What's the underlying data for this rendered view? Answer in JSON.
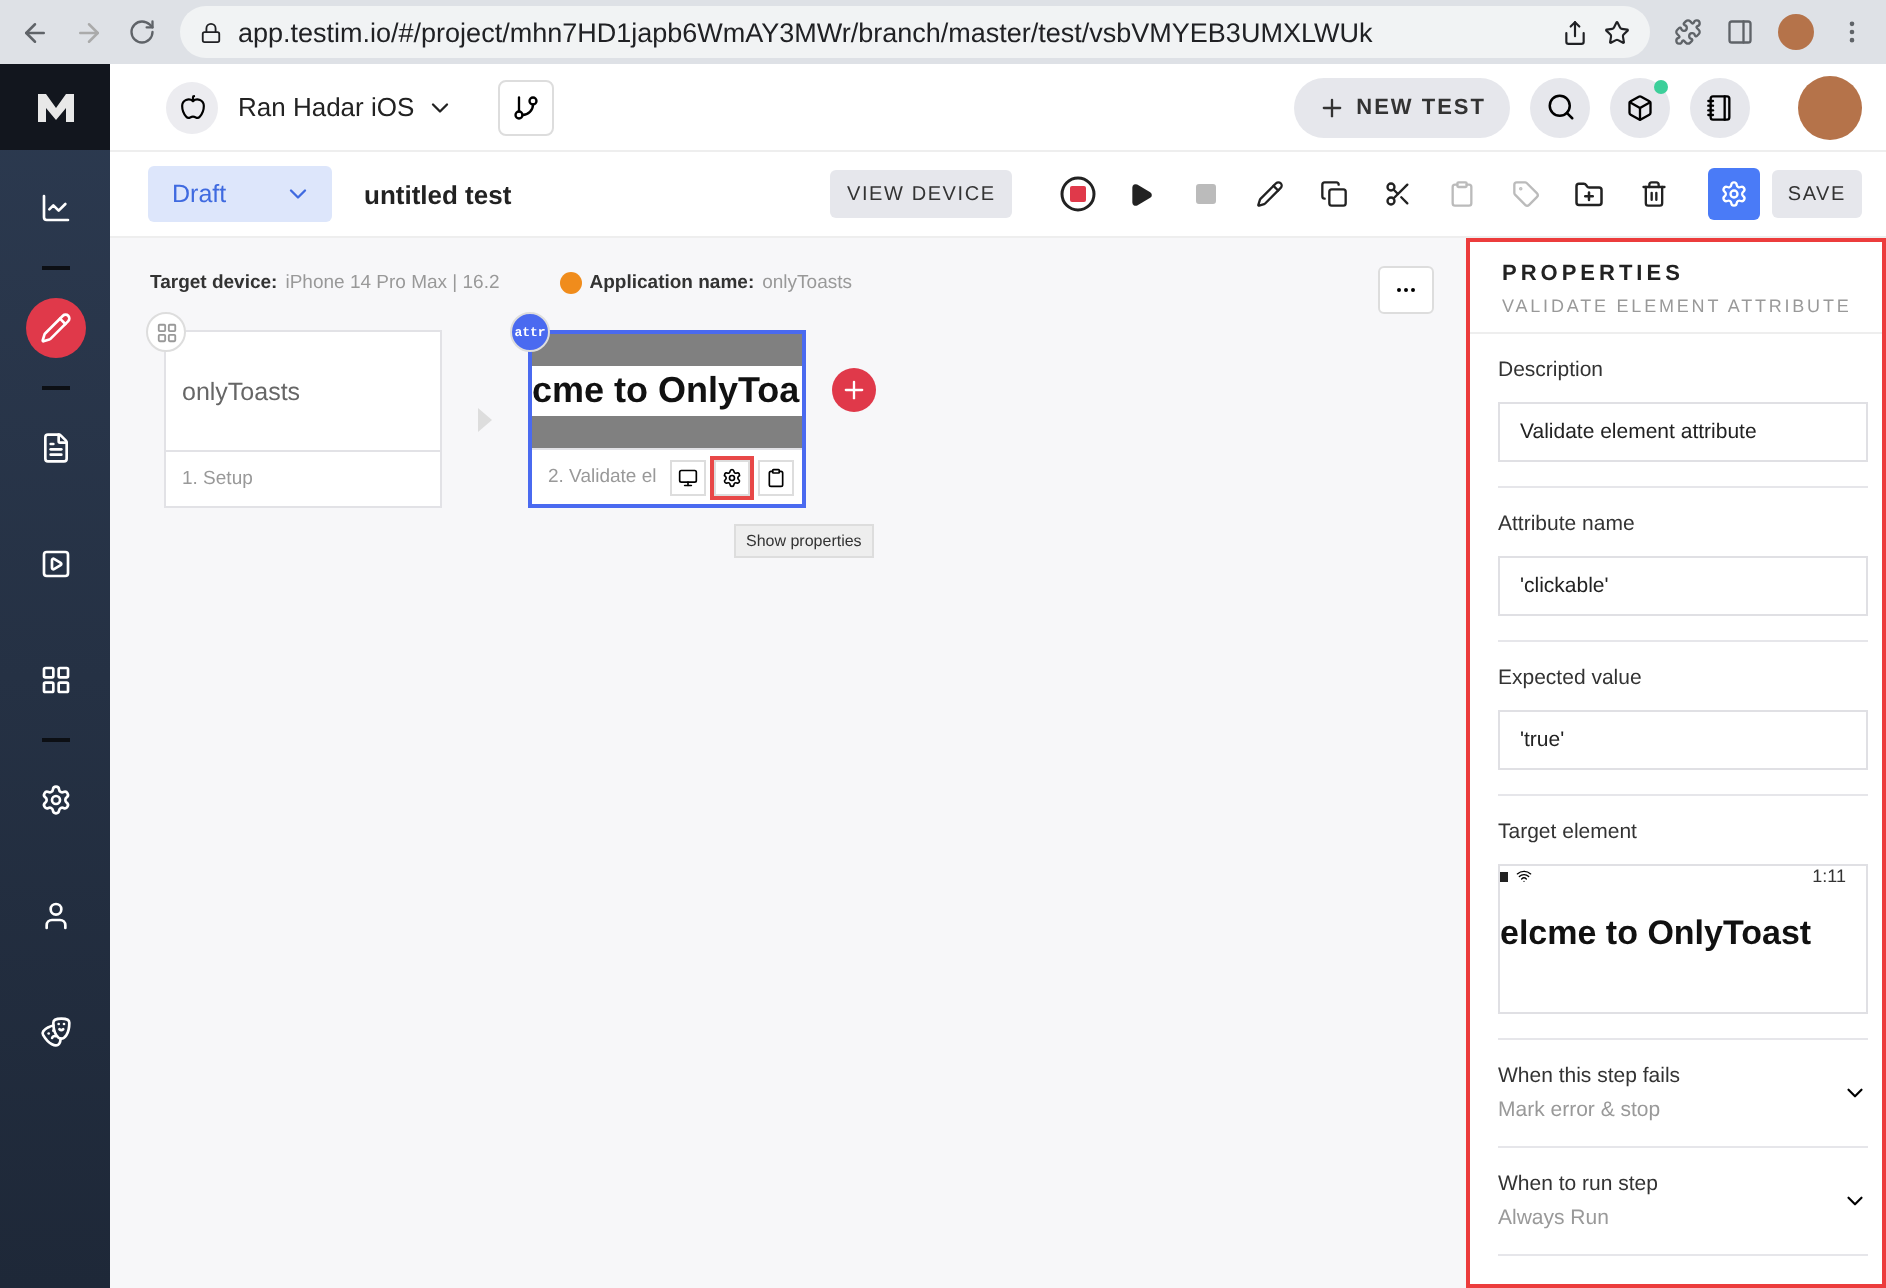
{
  "browser": {
    "url": "app.testim.io/#/project/mhn7HD1japb6WmAY3MWr/branch/master/test/vsbVMYEB3UMXLWUk"
  },
  "sidebar": {
    "items": [
      {
        "kind": "chart",
        "selected": false
      },
      {
        "kind": "edit",
        "selected": true
      },
      {
        "kind": "list",
        "selected": false
      },
      {
        "kind": "play",
        "selected": false
      },
      {
        "kind": "grid",
        "selected": false
      },
      {
        "kind": "settings",
        "selected": false
      },
      {
        "kind": "user",
        "selected": false
      },
      {
        "kind": "mask",
        "selected": false
      }
    ]
  },
  "header": {
    "project": "Ran Hadar iOS",
    "new_test": "NEW TEST"
  },
  "toolbar": {
    "status": "Draft",
    "test_name": "untitled test",
    "view_device": "VIEW DEVICE",
    "save": "SAVE",
    "properties_selected": true
  },
  "canvas": {
    "target_device_label": "Target device:",
    "target_device": "iPhone 14 Pro Max | 16.2",
    "app_name_label": "Application name:",
    "app_name": "onlyToasts",
    "steps": [
      {
        "kind": "setup",
        "title": "onlyToasts",
        "caption": "1. Setup",
        "selected": false
      },
      {
        "kind": "screenshot",
        "badge": "attr",
        "screenshot_text": "cme to OnlyToa",
        "caption": "2. Validate el",
        "selected": true
      }
    ],
    "tooltip": "Show properties"
  },
  "properties": {
    "title": "PROPERTIES",
    "subtitle": "VALIDATE ELEMENT ATTRIBUTE",
    "fields": [
      {
        "label": "Description",
        "value": "Validate element attribute"
      },
      {
        "label": "Attribute name",
        "value": "'clickable'"
      },
      {
        "label": "Expected value",
        "value": "'true'"
      }
    ],
    "target_label": "Target element",
    "target_time": "1:11",
    "target_text": "elcme to OnlyToast",
    "dropdowns": [
      {
        "label": "When this step fails",
        "value": "Mark error & stop"
      },
      {
        "label": "When to run step",
        "value": "Always Run"
      }
    ]
  }
}
